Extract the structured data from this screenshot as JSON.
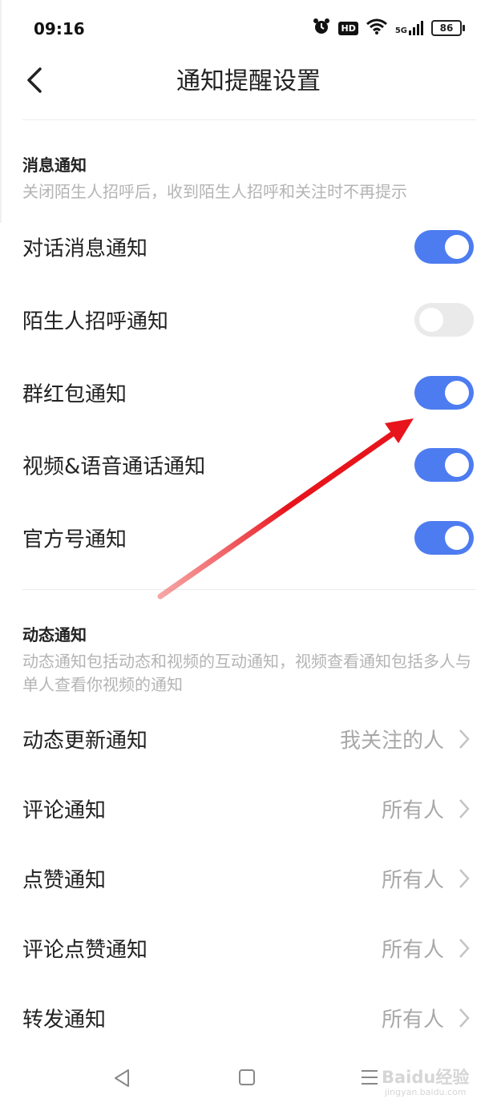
{
  "status_bar": {
    "time": "09:16",
    "hd_badge": "HD",
    "network": "5G",
    "battery": "86",
    "icons": [
      "alarm-icon",
      "hd-icon",
      "wifi-icon",
      "5g-signal-icon",
      "battery-icon"
    ]
  },
  "header": {
    "title": "通知提醒设置",
    "back_icon": "back-arrow-icon"
  },
  "message_section": {
    "title": "消息通知",
    "description": "关闭陌生人招呼后，收到陌生人招呼和关注时不再提示",
    "toggles": [
      {
        "label": "对话消息通知",
        "on": true
      },
      {
        "label": "陌生人招呼通知",
        "on": false
      },
      {
        "label": "群红包通知",
        "on": true
      },
      {
        "label": "视频&语音通话通知",
        "on": true
      },
      {
        "label": "官方号通知",
        "on": true
      }
    ]
  },
  "feed_section": {
    "title": "动态通知",
    "description": "动态通知包括动态和视频的互动通知，视频查看通知包括多人与单人查看你视频的通知",
    "items": [
      {
        "label": "动态更新通知",
        "value": "我关注的人"
      },
      {
        "label": "评论通知",
        "value": "所有人"
      },
      {
        "label": "点赞通知",
        "value": "所有人"
      },
      {
        "label": "评论点赞通知",
        "value": "所有人"
      },
      {
        "label": "转发通知",
        "value": "所有人"
      }
    ]
  },
  "nav_bar": {
    "icons": [
      "back-triangle-icon",
      "home-square-icon",
      "menu-lines-icon"
    ]
  },
  "watermark": {
    "text": "Baidu经验",
    "subtext": "jingyan.baidu.com"
  },
  "colors": {
    "toggle_on": "#4d7cf0",
    "toggle_off": "#eaeaea",
    "annotation_arrow": "#e8141c"
  }
}
